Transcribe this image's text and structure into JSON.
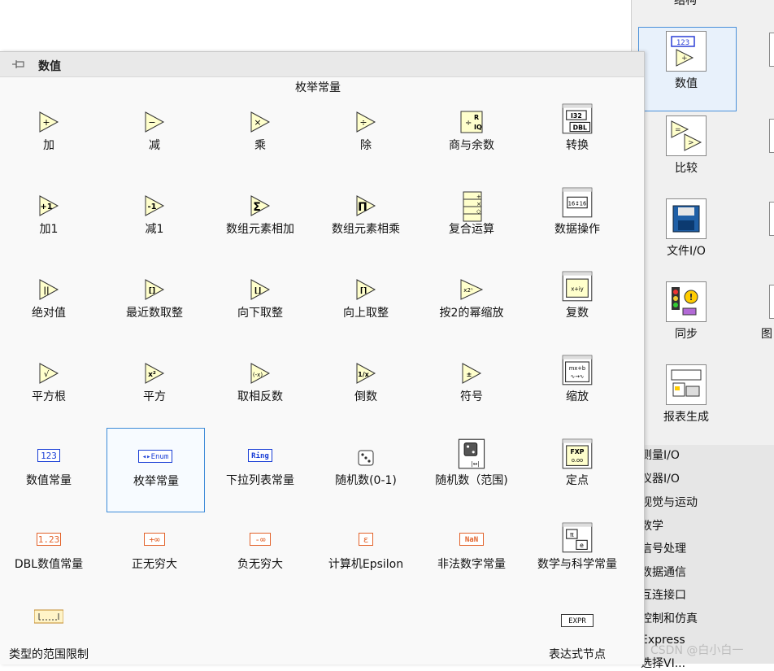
{
  "background_palette": {
    "top_label": "结构",
    "categories": [
      {
        "label": "数值",
        "icon": "numeric-icon"
      },
      {
        "label": "比较",
        "icon": "comparison-icon"
      },
      {
        "label": "文件I/O",
        "icon": "file-io-icon"
      },
      {
        "label": "同步",
        "icon": "synchronization-icon"
      },
      {
        "label": "报表生成",
        "icon": "report-generation-icon"
      }
    ],
    "right_edge_label": "图",
    "list": [
      "测量I/O",
      "仪器I/O",
      "视觉与运动",
      "数学",
      "信号处理",
      "数据通信",
      "互连接口",
      "控制和仿真",
      "Express",
      "选择VI..."
    ],
    "watermark": "CSDN @白小白一"
  },
  "panel": {
    "title": "数值",
    "hover_label": "枚举常量",
    "items": [
      {
        "label": "加",
        "icon": "add-icon"
      },
      {
        "label": "减",
        "icon": "subtract-icon"
      },
      {
        "label": "乘",
        "icon": "multiply-icon"
      },
      {
        "label": "除",
        "icon": "divide-icon"
      },
      {
        "label": "商与余数",
        "icon": "quotient-remainder-icon"
      },
      {
        "label": "转换",
        "icon": "conversion-icon"
      },
      {
        "label": "加1",
        "icon": "increment-icon"
      },
      {
        "label": "减1",
        "icon": "decrement-icon"
      },
      {
        "label": "数组元素相加",
        "icon": "add-array-elements-icon"
      },
      {
        "label": "数组元素相乘",
        "icon": "multiply-array-elements-icon"
      },
      {
        "label": "复合运算",
        "icon": "compound-arithmetic-icon"
      },
      {
        "label": "数据操作",
        "icon": "data-manipulation-icon"
      },
      {
        "label": "绝对值",
        "icon": "absolute-value-icon"
      },
      {
        "label": "最近数取整",
        "icon": "round-nearest-icon"
      },
      {
        "label": "向下取整",
        "icon": "round-down-icon"
      },
      {
        "label": "向上取整",
        "icon": "round-up-icon"
      },
      {
        "label": "按2的幂缩放",
        "icon": "scale-by-power-of-2-icon"
      },
      {
        "label": "复数",
        "icon": "complex-icon"
      },
      {
        "label": "平方根",
        "icon": "square-root-icon"
      },
      {
        "label": "平方",
        "icon": "square-icon"
      },
      {
        "label": "取相反数",
        "icon": "negate-icon"
      },
      {
        "label": "倒数",
        "icon": "reciprocal-icon"
      },
      {
        "label": "符号",
        "icon": "sign-icon"
      },
      {
        "label": "缩放",
        "icon": "scaling-icon"
      },
      {
        "label": "数值常量",
        "icon": "numeric-constant-icon",
        "text": "123"
      },
      {
        "label": "枚举常量",
        "icon": "enum-constant-icon",
        "text": "◂▸Enum"
      },
      {
        "label": "下拉列表常量",
        "icon": "ring-constant-icon",
        "text": "Ring"
      },
      {
        "label": "随机数(0-1)",
        "icon": "random-number-icon"
      },
      {
        "label": "随机数（范围)",
        "icon": "random-number-range-icon"
      },
      {
        "label": "定点",
        "icon": "fixed-point-icon",
        "text": "FXP"
      },
      {
        "label": "DBL数值常量",
        "icon": "dbl-constant-icon",
        "text": "1.23"
      },
      {
        "label": "正无穷大",
        "icon": "positive-infinity-icon",
        "text": "+∞"
      },
      {
        "label": "负无穷大",
        "icon": "negative-infinity-icon",
        "text": "-∞"
      },
      {
        "label": "计算机Epsilon",
        "icon": "epsilon-icon",
        "text": "ε"
      },
      {
        "label": "非法数字常量",
        "icon": "nan-constant-icon",
        "text": "NaN"
      },
      {
        "label": "数学与科学常量",
        "icon": "math-science-constants-icon"
      },
      {
        "label": "类型的范围限制",
        "icon": "range-limit-icon"
      },
      {
        "label": "表达式节点",
        "icon": "expression-node-icon",
        "text": "EXPR"
      }
    ]
  }
}
